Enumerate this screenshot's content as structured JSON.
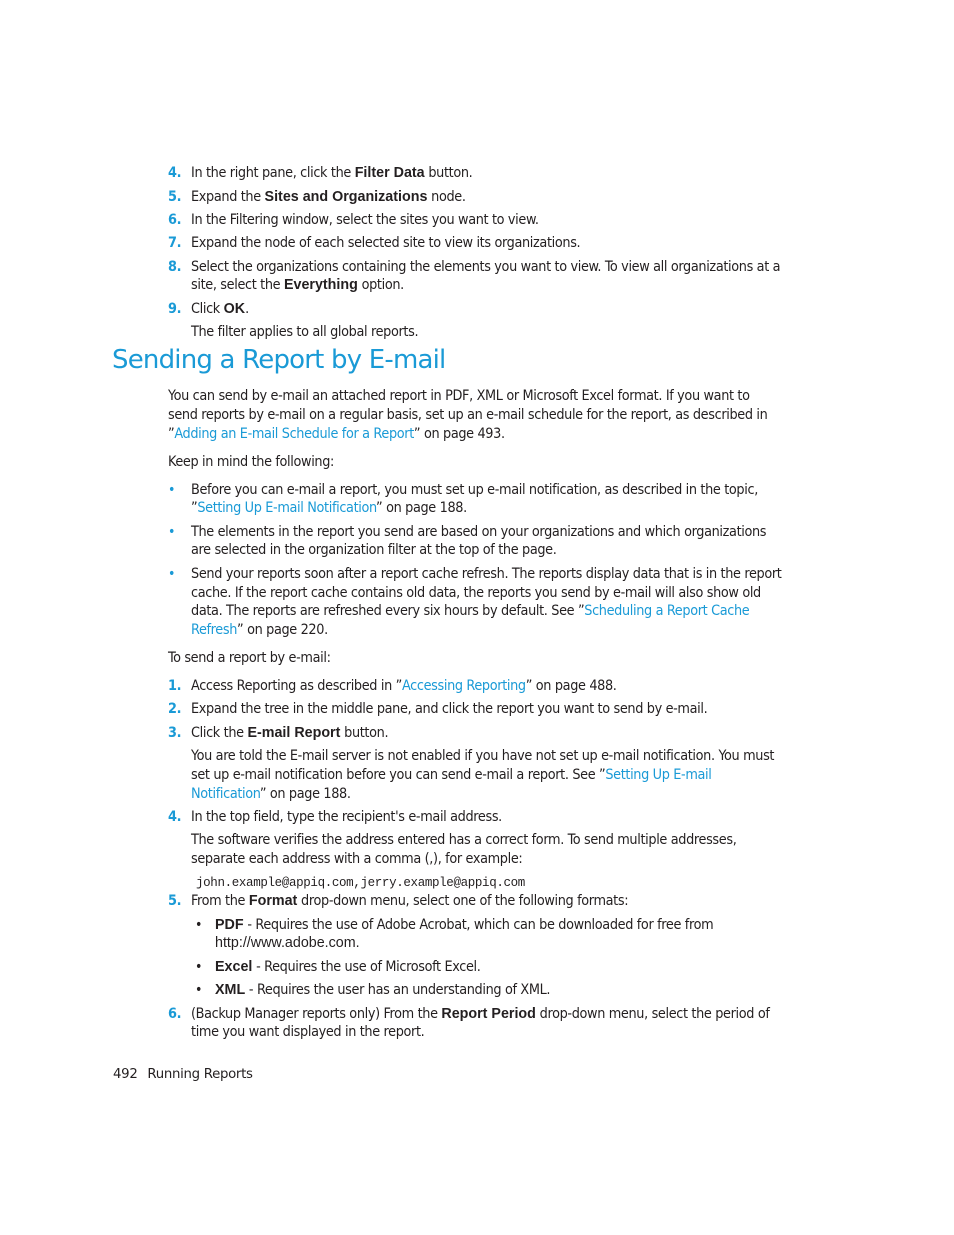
{
  "steps_top": [
    {
      "num": "4.",
      "pre": "In the right pane, click the ",
      "bold": "Filter Data",
      "post": " button."
    },
    {
      "num": "5.",
      "pre": "Expand the ",
      "bold": "Sites and Organizations",
      "post": " node."
    },
    {
      "num": "6.",
      "text": "In the Filtering window, select the sites you want to view."
    },
    {
      "num": "7.",
      "text": "Expand the node of each selected site to view its organizations."
    },
    {
      "num": "8.",
      "line1": "Select the organizations containing the elements you want to view. To view all organizations at a",
      "pre": "site, select the ",
      "bold": "Everything",
      "post": " option."
    },
    {
      "num": "9.",
      "pre": "Click ",
      "bold": "OK",
      "post": ".",
      "note": "The filter applies to all global reports."
    }
  ],
  "section": {
    "title": "Sending a Report by E-mail",
    "intro": {
      "line1": "You can send by e-mail an attached report in PDF, XML or Microsoft Excel format. If you want to",
      "line2": "send reports by e-mail on a regular basis, set up an e-mail schedule for the report, as described in",
      "line3_pre": "”",
      "line3_link": "Adding an E-mail Schedule for a Report",
      "line3_post": "” on page 493."
    },
    "keep_in_mind": "Keep in mind the following:",
    "bullets": [
      {
        "line1": "Before you can e-mail a report, you must set up e-mail notification, as described in the topic,",
        "line2_pre": "”",
        "line2_link": "Setting Up E-mail Notification",
        "line2_post": "” on page 188."
      },
      {
        "line1": "The elements in the report you send are based on your organizations and which organizations",
        "line2": "are selected in the organization filter at the top of the page."
      },
      {
        "line1": "Send your reports soon after a report cache refresh. The reports display data that is in the report",
        "line2": "cache. If the report cache contains old data, the reports you send by e-mail will also show old",
        "line3_pre": "data. The reports are refreshed every six hours by default. See ”",
        "line3_link": "Scheduling a Report Cache",
        "line4_link": "Refresh",
        "line4_post": "” on page 220."
      }
    ],
    "to_send": "To send a report by e-mail:",
    "steps": [
      {
        "num": "1.",
        "pre": "Access Reporting as described in ”",
        "link": "Accessing Reporting",
        "post": "” on page 488."
      },
      {
        "num": "2.",
        "text": "Expand the tree in the middle pane, and click the report you want to send by e-mail."
      },
      {
        "num": "3.",
        "pre": "Click the ",
        "bold": "E-mail Report",
        "post": " button.",
        "note1": "You are told the E-mail server is not enabled if you have not set up e-mail notification. You must",
        "note2_pre": "set up e-mail notification before you can send e-mail a report. See ”",
        "note2_link": "Setting Up E-mail",
        "note3_link": "Notification",
        "note3_post": "” on page 188."
      },
      {
        "num": "4.",
        "text": "In the top field, type the recipient's e-mail address.",
        "note1": "The software verifies the address entered has a correct form. To send multiple addresses,",
        "note2": "separate each address with a comma (,), for example:",
        "code": "john.example@appiq.com,jerry.example@appiq.com"
      },
      {
        "num": "5.",
        "pre": "From the ",
        "bold": "Format",
        "post": " drop-down menu, select one of the following formats:",
        "formats": [
          {
            "name": "PDF",
            "desc": " - Requires the use of Adobe Acrobat, which can be downloaded for free from",
            "desc2": "http://www.adobe.com."
          },
          {
            "name": "Excel",
            "desc": " - Requires the use of Microsoft Excel."
          },
          {
            "name": "XML",
            "desc": " - Requires the user has an understanding of XML."
          }
        ]
      },
      {
        "num": "6.",
        "pre": "(Backup Manager reports only) From the ",
        "bold": "Report Period",
        "post": " drop-down menu, select the period of",
        "line2": "time you want displayed in the report."
      }
    ]
  },
  "footer": {
    "page": "492",
    "chapter": "Running Reports"
  }
}
